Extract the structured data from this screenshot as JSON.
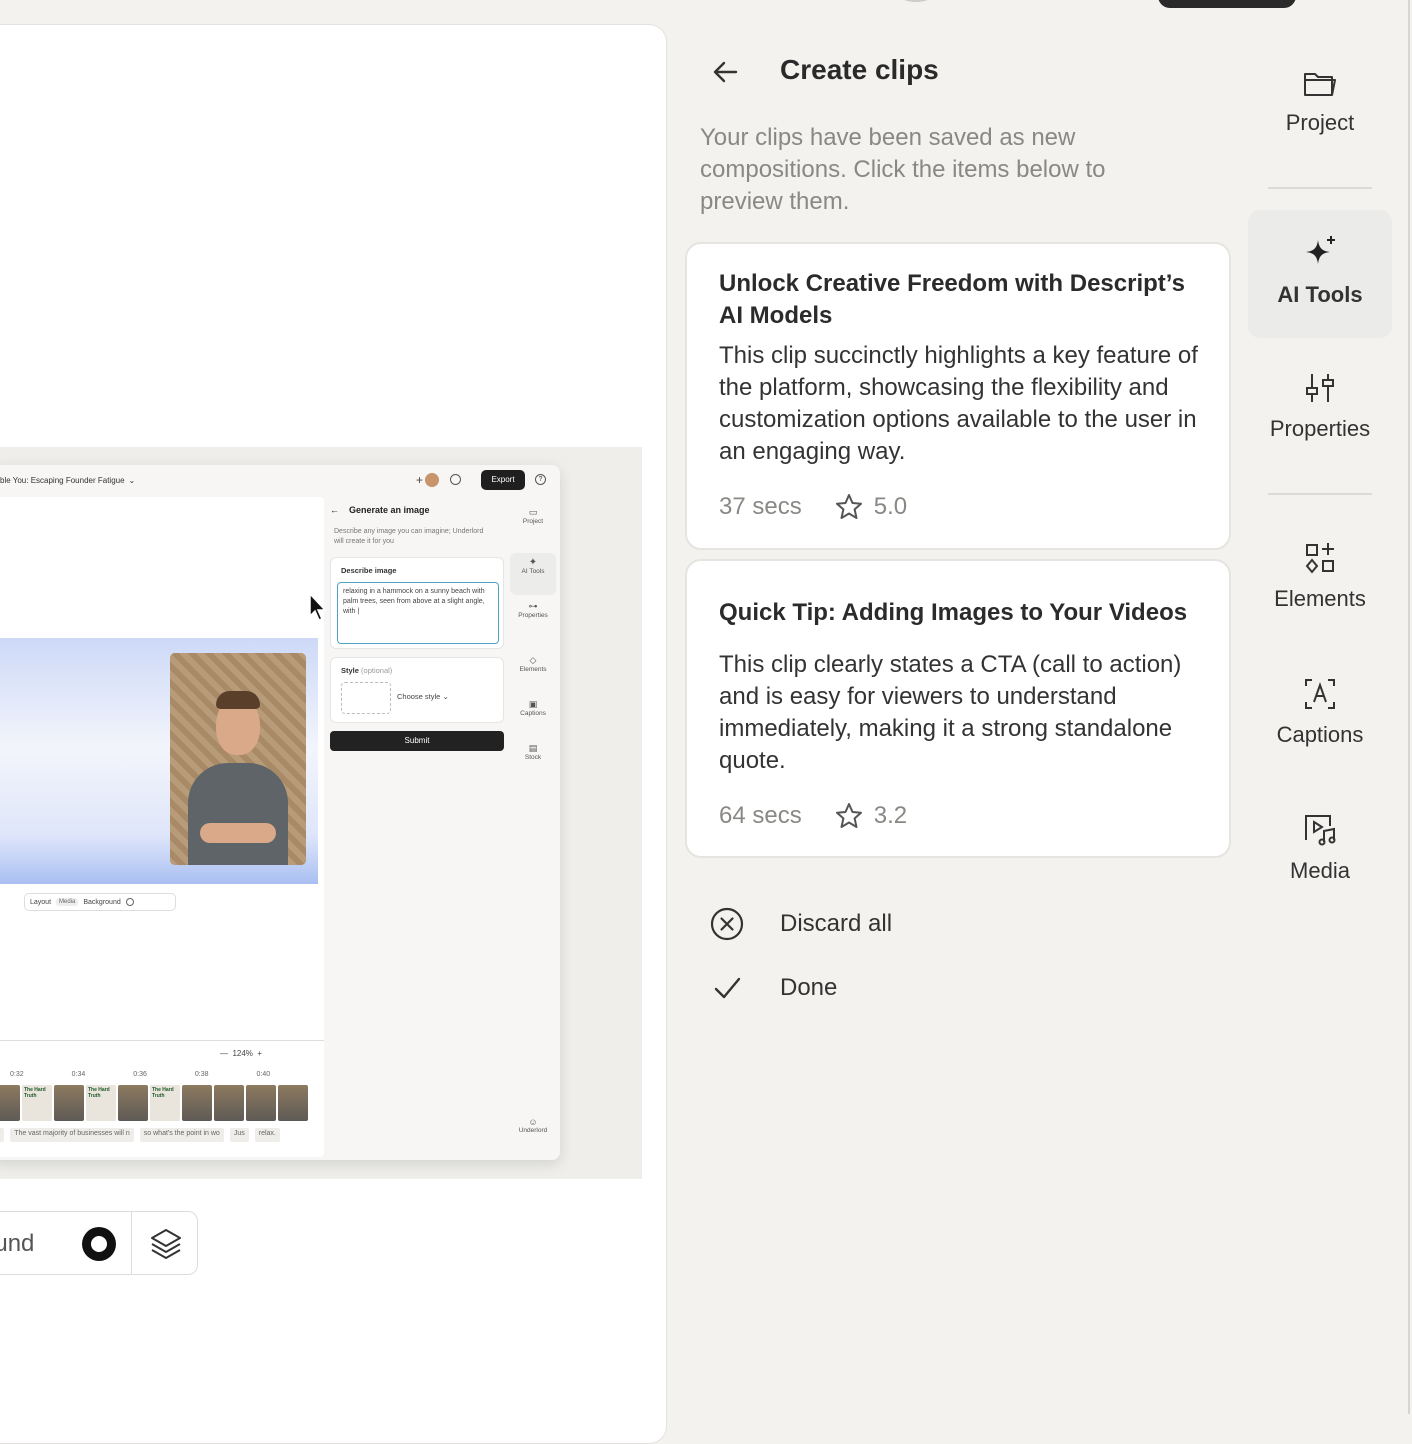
{
  "canvas": {
    "doc_title": "ble You: Escaping Founder Fatigue",
    "export_label": "Export",
    "help_label": "?",
    "generate": {
      "back_arrow": "←",
      "title": "Generate an image",
      "description": "Describe any image you can imagine; Underlord will create it for you",
      "describe_label": "Describe image",
      "prompt_text": "relaxing in a hammock on a sunny beach with palm trees, seen from above at a slight angle, with |",
      "style_label": "Style",
      "style_optional": "(optional)",
      "style_select": "Choose style",
      "submit_label": "Submit"
    },
    "mini_rail": [
      "Project",
      "AI Tools",
      "Properties",
      "Elements",
      "Captions",
      "Stock",
      "Underlord"
    ],
    "layout_bar": {
      "layout": "Layout",
      "media": "Media",
      "background": "Background"
    },
    "zoom": "124%",
    "ticks": [
      "0:32",
      "0:34",
      "0:36",
      "0:38",
      "0:40"
    ],
    "clip_text": "The Hard Truth",
    "transcript": [
      "ar",
      "The vast majority of businesses will n",
      "so what's the point in wo",
      "Jus",
      "relax."
    ],
    "toolbar_background_label": "ound"
  },
  "panel": {
    "title": "Create clips",
    "description": "Your clips have been saved as new compositions. Click the items below to preview them.",
    "clips": [
      {
        "title": "Unlock Creative Freedom with Descript’s AI Models",
        "description": "This clip succinctly highlights a key feature of the platform, showcasing the flexibility and customization options available to the user in an engaging way.",
        "duration": "37 secs",
        "rating": "5.0"
      },
      {
        "title": "Quick Tip: Adding Images to Your Videos",
        "description": "This clip clearly states a CTA (call to action) and is easy for viewers to understand immediately, making it a strong standalone quote.",
        "duration": "64 secs",
        "rating": "3.2"
      }
    ],
    "discard_label": "Discard all",
    "done_label": "Done"
  },
  "rail": {
    "items": [
      {
        "label": "Project",
        "icon": "folder-icon"
      },
      {
        "label": "AI Tools",
        "icon": "sparkle-icon",
        "active": true
      },
      {
        "label": "Properties",
        "icon": "sliders-icon"
      },
      {
        "label": "Elements",
        "icon": "shapes-icon"
      },
      {
        "label": "Captions",
        "icon": "captions-icon"
      },
      {
        "label": "Media",
        "icon": "media-icon"
      }
    ]
  },
  "colors": {
    "background": "#f3f2ef",
    "card": "#ffffff",
    "active_rail": "#ebebe9",
    "muted_text": "#8a8884"
  }
}
